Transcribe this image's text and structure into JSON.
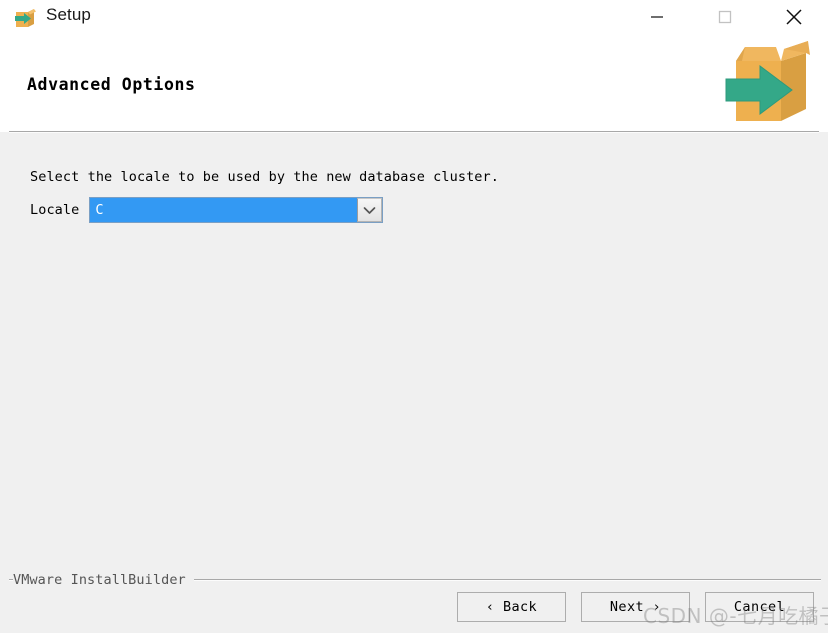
{
  "window": {
    "title": "Setup",
    "icon": "installer-box-icon",
    "controls": {
      "minimize": "—",
      "maximize": "□",
      "close": "✕"
    }
  },
  "header": {
    "title": "Advanced Options",
    "logo": "installer-box-logo"
  },
  "main": {
    "instruction": "Select the locale to be used by the new database cluster.",
    "locale": {
      "label": "Locale",
      "value": "C",
      "arrow_icon": "chevron-down-icon"
    }
  },
  "footer": {
    "brand": "VMware InstallBuilder",
    "buttons": {
      "back": "‹ Back",
      "next": "Next ›",
      "cancel": "Cancel"
    }
  },
  "watermark": {
    "text": "CSDN @-七月吃橘子"
  },
  "colors": {
    "window_background": "#f0f0f0",
    "titlebar_background": "#ffffff",
    "selection_blue": "#3399f3",
    "logo_box": "#eeb04f",
    "logo_arrow": "#34a888",
    "rule": "#a8a8a8"
  }
}
